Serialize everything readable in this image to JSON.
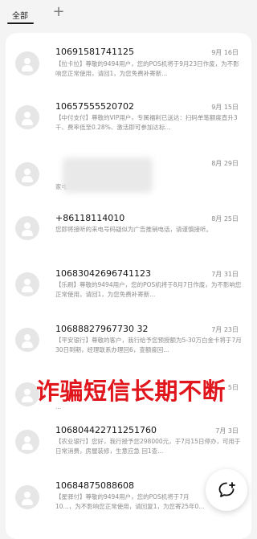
{
  "tabs": {
    "all_label": "全部",
    "add_label": "+"
  },
  "messages": [
    {
      "sender": "10691581741125",
      "date": "9月 16日",
      "preview": "【拉卡拉】尊敬的9494用户，您的POS机将于9月23日作废，为不影响您正常使用，请回1，为您免费补寄新..."
    },
    {
      "sender": "10657555520702",
      "date": "9月 15日",
      "preview": "【中付支付】尊敬的VIP用户，专属福利已送达：扫码单笔额度直升3千、费率低至0.28%、激活即可参加达标..."
    },
    {
      "sender": "",
      "date": "8月 29日",
      "preview": "家电..."
    },
    {
      "sender": "+86118114010",
      "date": "8月 25日",
      "preview": "您即将接听的来电号码疑似为广告推销电话，请谨慎接听。"
    },
    {
      "sender": "10683042696741123",
      "date": "7月 31日",
      "preview": "【乐刷】尊敬的9494用户，您的POS机将于8月7日作废，为不影响您正常使用，请回1，为您免费补寄新..."
    },
    {
      "sender": "10688827967730 32",
      "date": "7月 23日",
      "preview": "【平安银行】尊敬的客户，我行给予您预授额为5-30万白金卡将于7月30日到期，经理联系办理回6，查额度回..."
    },
    {
      "sender": "",
      "date": "5日",
      "preview": "..."
    },
    {
      "sender": "106804422711251760",
      "date": "7月 3日",
      "preview": "【农业银行】您好，我行授予您298000元，于7月15日停办，可用于日常消费，房屋装修，生意应急 回1查..."
    },
    {
      "sender": "10684875088608",
      "date": "",
      "preview": "【星驿付】尊敬的9494用户，您的POS机将于7月10...，为不影响您正常使用，请回复1，为您寄25年0..."
    }
  ],
  "overlay": {
    "caption": "诈骗短信长期不断"
  },
  "fab": {
    "icon": "new-message-icon"
  }
}
